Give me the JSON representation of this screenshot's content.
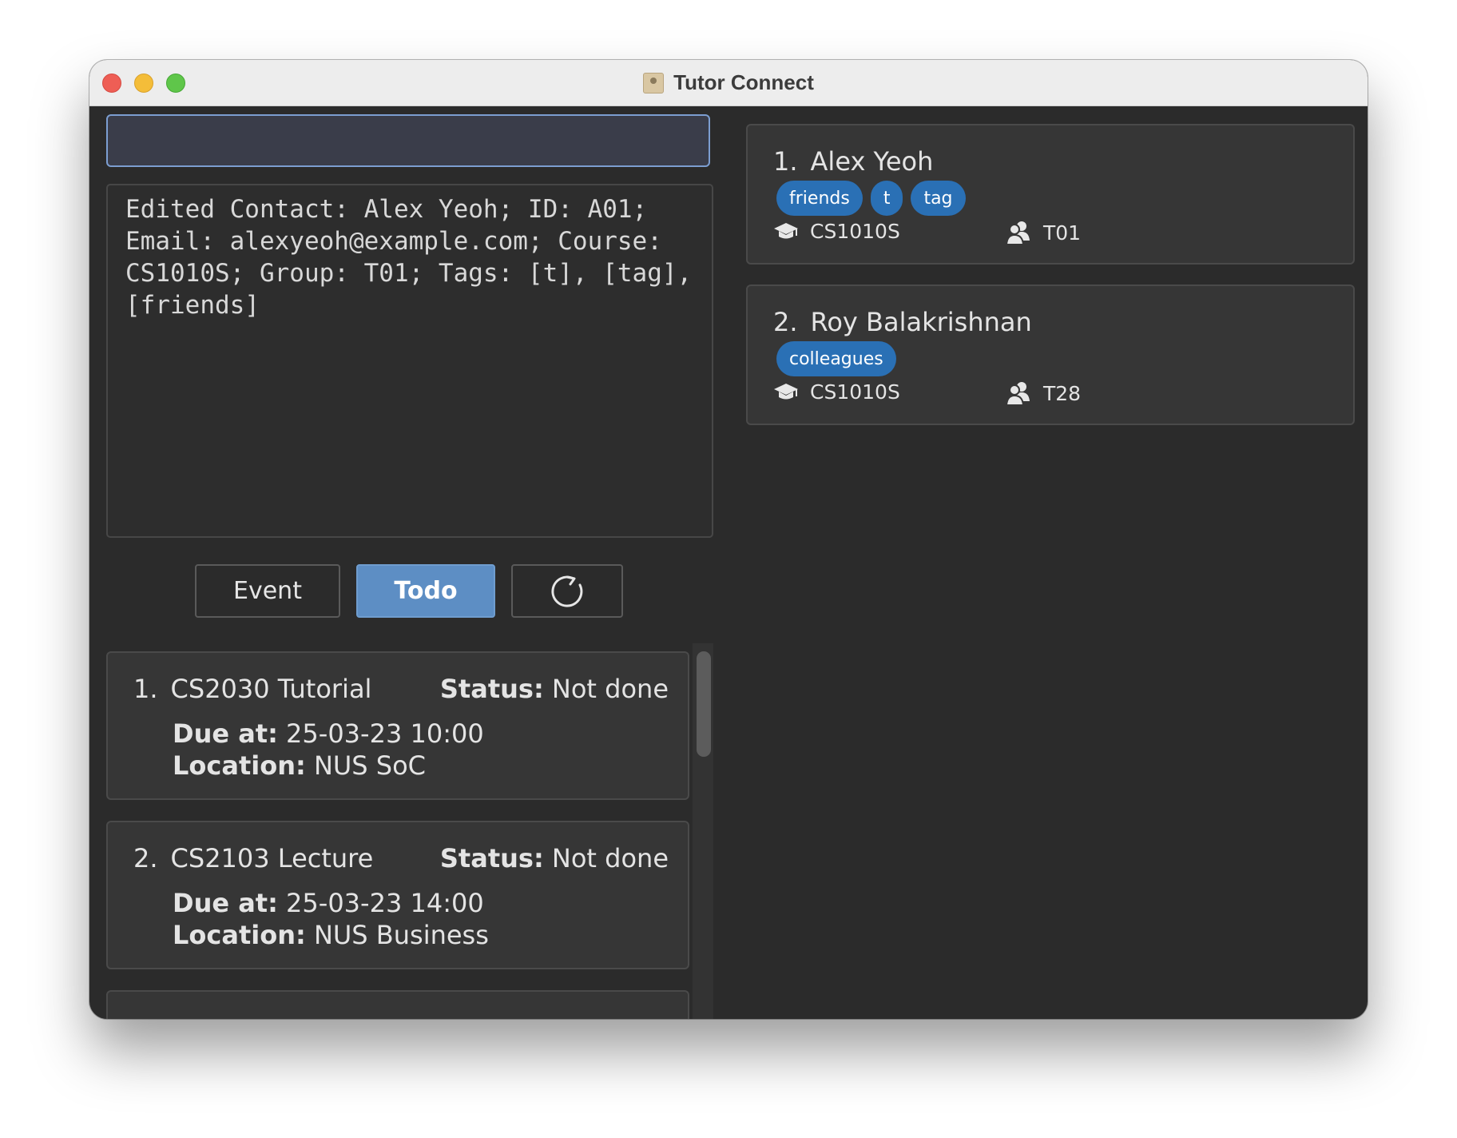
{
  "window": {
    "title": "Tutor Connect"
  },
  "command_box": {
    "value": ""
  },
  "result_display": {
    "text": "Edited Contact: Alex Yeoh; ID: A01; Email: alexyeoh@example.com; Course: CS1010S; Group: T01; Tags: [t], [tag], [friends]"
  },
  "toolbar": {
    "event_label": "Event",
    "todo_label": "Todo",
    "refresh_icon": "refresh-icon",
    "active": "Todo"
  },
  "todos": [
    {
      "index": "1.",
      "title": "CS2030 Tutorial",
      "status_label": "Status:",
      "status": "Not done",
      "due_label": "Due at:",
      "due": "25-03-23 10:00",
      "location_label": "Location:",
      "location": "NUS SoC"
    },
    {
      "index": "2.",
      "title": "CS2103 Lecture",
      "status_label": "Status:",
      "status": "Not done",
      "due_label": "Due at:",
      "due": "25-03-23 14:00",
      "location_label": "Location:",
      "location": "NUS Business"
    }
  ],
  "persons": [
    {
      "index": "1.",
      "name": "Alex Yeoh",
      "tags": [
        "friends",
        "t",
        "tag"
      ],
      "course_icon": "graduation-cap-icon",
      "course": "CS1010S",
      "group_icon": "group-icon",
      "group": "T01"
    },
    {
      "index": "2.",
      "name": "Roy Balakrishnan",
      "tags": [
        "colleagues"
      ],
      "course_icon": "graduation-cap-icon",
      "course": "CS1010S",
      "group_icon": "group-icon",
      "group": "T28"
    }
  ],
  "colors": {
    "background": "#2b2b2b",
    "card": "#363636",
    "accent": "#5d8ec4",
    "tag": "#2a70b5",
    "command_border": "#7c9ed1"
  }
}
